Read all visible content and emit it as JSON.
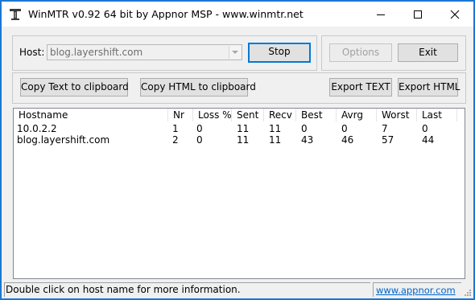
{
  "window": {
    "title": "WinMTR v0.92 64 bit by Appnor MSP - www.winmtr.net",
    "icon": "winmtr-app-icon"
  },
  "controls": {
    "host_label": "Host:",
    "host_value": "blog.layershift.com",
    "stop_label": "Stop",
    "options_label": "Options",
    "exit_label": "Exit",
    "copy_text_label": "Copy Text to clipboard",
    "copy_html_label": "Copy HTML to clipboard",
    "export_text_label": "Export TEXT",
    "export_html_label": "Export HTML"
  },
  "table": {
    "columns": [
      "Hostname",
      "Nr",
      "Loss %",
      "Sent",
      "Recv",
      "Best",
      "Avrg",
      "Worst",
      "Last"
    ],
    "rows": [
      [
        "10.0.2.2",
        "1",
        "0",
        "11",
        "11",
        "0",
        "0",
        "7",
        "0"
      ],
      [
        "blog.layershift.com",
        "2",
        "0",
        "11",
        "11",
        "43",
        "46",
        "57",
        "44"
      ]
    ]
  },
  "status": {
    "message": "Double click on host name for more information.",
    "link": "www.appnor.com"
  },
  "colors": {
    "window_border": "#1a78d4",
    "default_button_border": "#0078d7",
    "link": "#0066cc"
  }
}
